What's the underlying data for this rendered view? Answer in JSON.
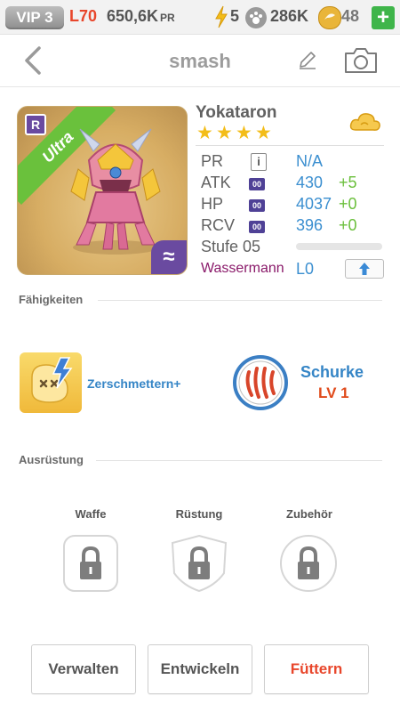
{
  "topbar": {
    "vip": "VIP 3",
    "level": "L70",
    "power": "650,6K",
    "power_unit": "PR",
    "energy": "5",
    "paws": "286K",
    "gems": "48",
    "plus": "+"
  },
  "header": {
    "title": "smash"
  },
  "monster": {
    "name": "Yokataron",
    "rarity": "Ultra",
    "rank_letter": "R",
    "stars": 4,
    "stats": [
      {
        "label": "PR",
        "value": "N/A",
        "plus": ""
      },
      {
        "label": "ATK",
        "badge": "00",
        "value": "430",
        "plus": "+5"
      },
      {
        "label": "HP",
        "badge": "00",
        "value": "4037",
        "plus": "+0"
      },
      {
        "label": "RCV",
        "badge": "00",
        "value": "396",
        "plus": "+0"
      }
    ],
    "stufe": "Stufe 05",
    "stufe_progress": 0,
    "element": "Wassermann",
    "element_level": "L0",
    "pr_info_icon": "i"
  },
  "skills": {
    "title": "Fähigkeiten",
    "skill_name": "Zerschmettern+",
    "class_name": "Schurke",
    "class_level": "LV 1"
  },
  "equipment": {
    "title": "Ausrüstung",
    "slots": [
      {
        "label": "Waffe"
      },
      {
        "label": "Rüstung"
      },
      {
        "label": "Zubehör"
      }
    ]
  },
  "actions": {
    "manage": "Verwalten",
    "evolve": "Entwickeln",
    "feed": "Füttern"
  },
  "colors": {
    "accent_blue": "#3b8fd0",
    "feed_red": "#e8462b",
    "plus_green": "#6abf3b",
    "ribbon_green": "#6ac13c"
  }
}
